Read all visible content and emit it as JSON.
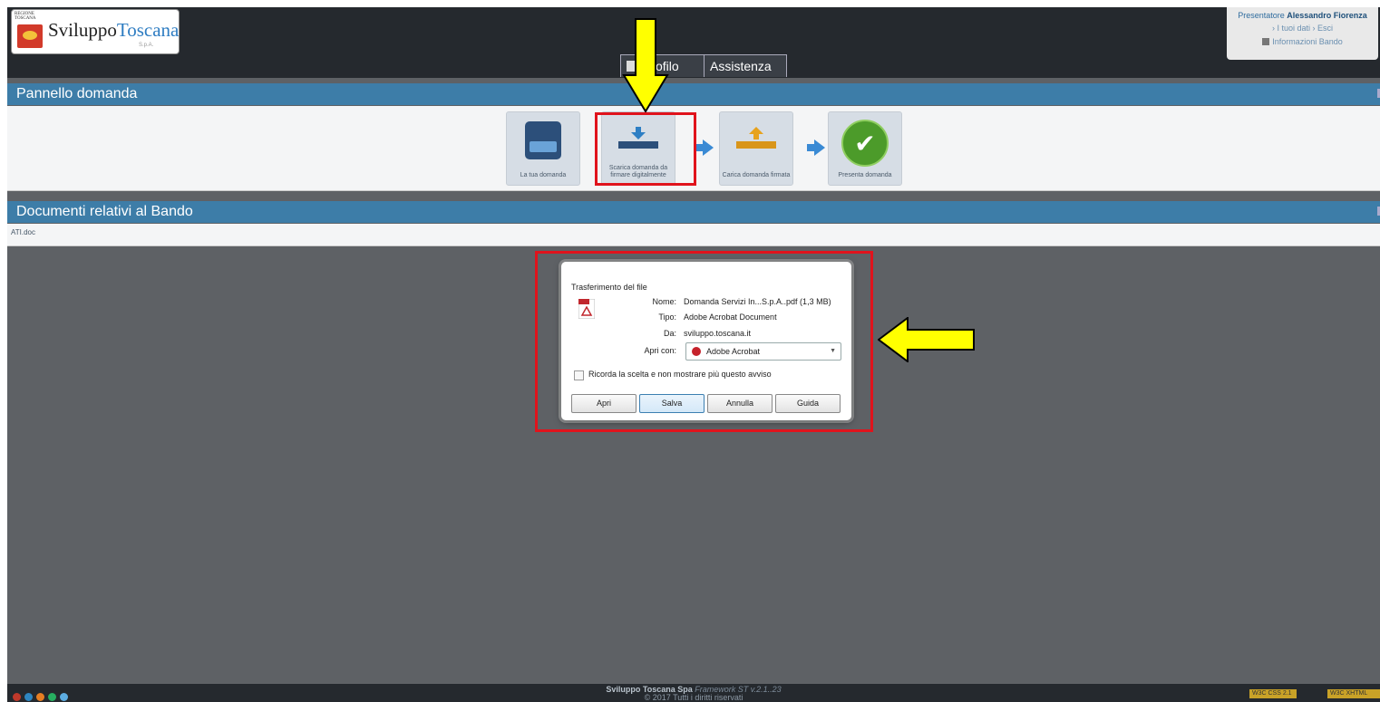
{
  "header": {
    "logo_region": "REGIONE TOSCANA",
    "logo_name_a": "Sviluppo",
    "logo_name_b": "Toscana",
    "logo_suffix": "S.p.A.",
    "user_prefix": "Presentatore",
    "user_name": "Alessandro Fiorenza",
    "user_links": "› I tuoi dati  › Esci",
    "info_link": "Informazioni Bando"
  },
  "tabs": [
    {
      "label": "Profilo"
    },
    {
      "label": "Assistenza"
    }
  ],
  "panels": {
    "domanda_title": "Pannello domanda",
    "documenti_title": "Documenti relativi al Bando"
  },
  "steps": [
    {
      "label": "La tua domanda"
    },
    {
      "label": "Scarica domanda da firmare digitalmente"
    },
    {
      "label": "Carica domanda firmata"
    },
    {
      "label": "Presenta domanda"
    }
  ],
  "documents": [
    "ATI.doc"
  ],
  "dialog": {
    "title": "Trasferimento del file",
    "name_key": "Nome:",
    "name_val": "Domanda Servizi In...S.p.A..pdf (1,3 MB)",
    "type_key": "Tipo:",
    "type_val": "Adobe Acrobat Document",
    "from_key": "Da:",
    "from_val": "sviluppo.toscana.it",
    "open_key": "Apri con:",
    "open_val": "Adobe Acrobat",
    "remember": "Ricorda la scelta e non mostrare più questo avviso",
    "btn_open": "Apri",
    "btn_save": "Salva",
    "btn_cancel": "Annulla",
    "btn_help": "Guida"
  },
  "footer": {
    "company": "Sviluppo Toscana Spa",
    "framework": "Framework ST v.2.1..23",
    "rights": "© 2017 Tutti i diritti riservati",
    "badge_css": "W3C CSS 2.1",
    "badge_xhtml": "W3C XHTML"
  },
  "colors": {
    "topbar": "#25292e",
    "panel_header": "#3d7da8",
    "annotation_red": "#e0131c",
    "annotation_yellow": "#ffff00"
  }
}
